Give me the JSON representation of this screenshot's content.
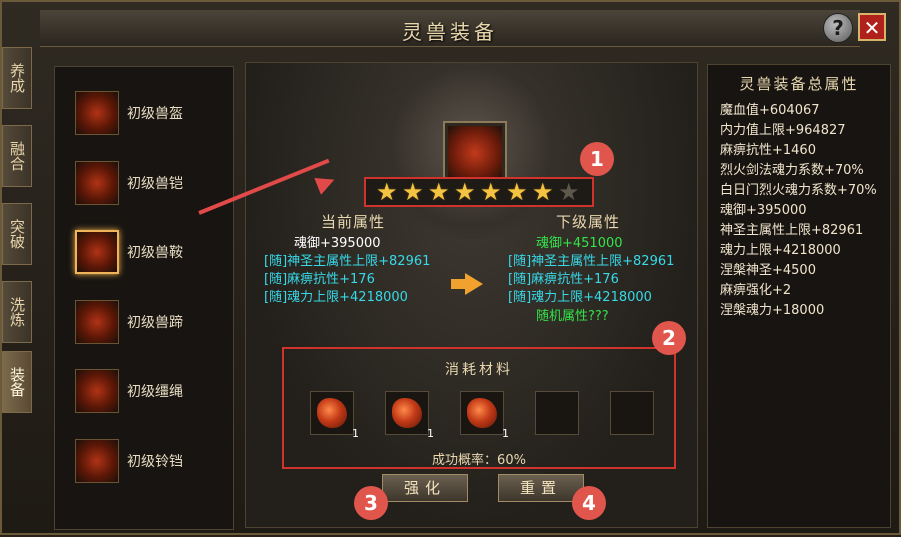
{
  "window": {
    "title": "灵兽装备",
    "help_label": "?",
    "close_label": "✕"
  },
  "tabs": [
    {
      "label": "养成"
    },
    {
      "label": "融合"
    },
    {
      "label": "突破"
    },
    {
      "label": "洗炼"
    },
    {
      "label": "装备",
      "active": true
    }
  ],
  "equipment_list": [
    {
      "label": "初级兽盔",
      "icon": "helmet-icon"
    },
    {
      "label": "初级兽铠",
      "icon": "armor-icon"
    },
    {
      "label": "初级兽鞍",
      "icon": "saddle-icon",
      "selected": true
    },
    {
      "label": "初级兽蹄",
      "icon": "hoof-icon"
    },
    {
      "label": "初级缰绳",
      "icon": "rein-icon"
    },
    {
      "label": "初级铃铛",
      "icon": "bell-icon"
    }
  ],
  "stars": {
    "filled": 7,
    "total": 8,
    "symbol": "★"
  },
  "badges": [
    "1",
    "2",
    "3",
    "4"
  ],
  "current": {
    "heading": "当前属性",
    "lines": [
      {
        "text": "魂御+395000",
        "color": "white"
      },
      {
        "text": "[随]神圣主属性上限+82961",
        "color": "cyan"
      },
      {
        "text": "[随]麻痹抗性+176",
        "color": "cyan"
      },
      {
        "text": "[随]魂力上限+4218000",
        "color": "cyan"
      }
    ]
  },
  "next": {
    "heading": "下级属性",
    "lines": [
      {
        "text": "魂御+451000",
        "color": "green"
      },
      {
        "text": "[随]神圣主属性上限+82961",
        "color": "cyan"
      },
      {
        "text": "[随]麻痹抗性+176",
        "color": "cyan"
      },
      {
        "text": "[随]魂力上限+4218000",
        "color": "cyan"
      },
      {
        "text": "随机属性???",
        "color": "green"
      }
    ]
  },
  "materials": {
    "title": "消耗材料",
    "slots": [
      {
        "count": "1",
        "filled": true
      },
      {
        "count": "1",
        "filled": true
      },
      {
        "count": "1",
        "filled": true
      },
      {
        "count": "",
        "filled": false
      },
      {
        "count": "",
        "filled": false
      }
    ],
    "success_rate": "成功概率：60%"
  },
  "buttons": {
    "strengthen": "强化",
    "reset": "重置"
  },
  "total_attributes": {
    "title": "灵兽装备总属性",
    "lines": [
      "魔血值+604067",
      "内力值上限+964827",
      "麻痹抗性+1460",
      "烈火剑法魂力系数+70%",
      "白日门烈火魂力系数+70%",
      "魂御+395000",
      "神圣主属性上限+82961",
      "魂力上限+4218000",
      "涅槃神圣+4500",
      "麻痹强化+2",
      "涅槃魂力+18000"
    ]
  },
  "colors": {
    "badge": "#e0554c",
    "star": "#f5c342",
    "cyan_text": "#37d9e8",
    "green_text": "#34e34a"
  }
}
